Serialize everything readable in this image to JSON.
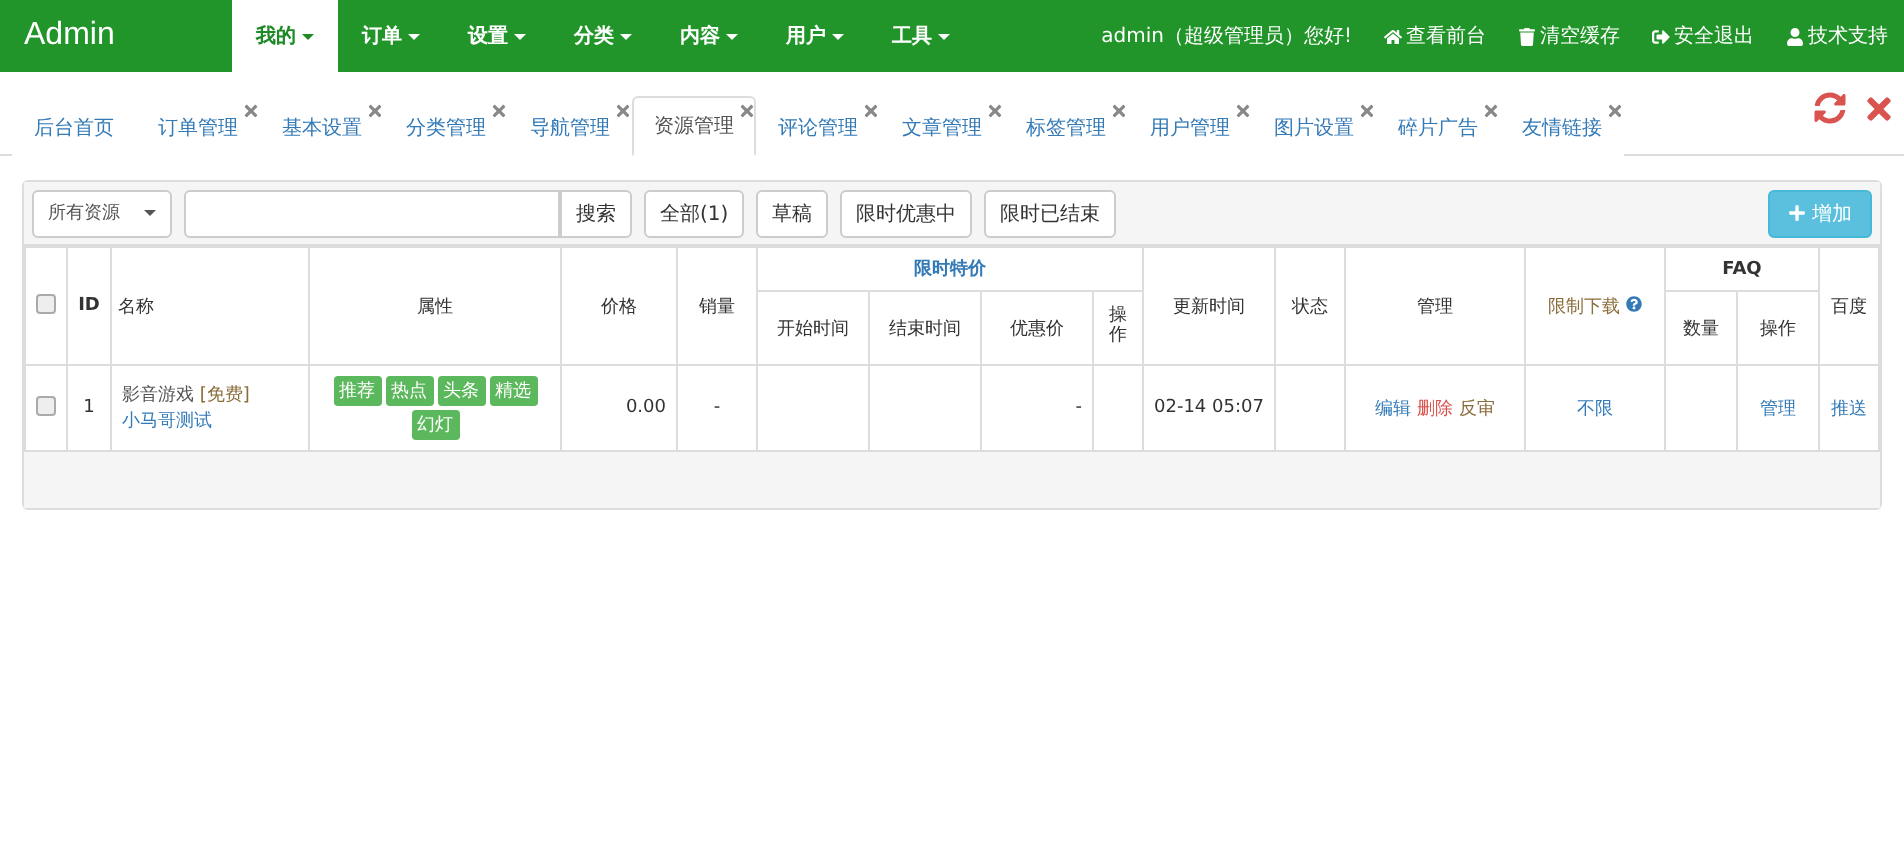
{
  "brand": "Admin",
  "menus": [
    {
      "label": "我的",
      "selected": true
    },
    {
      "label": "订单",
      "selected": false
    },
    {
      "label": "设置",
      "selected": false
    },
    {
      "label": "分类",
      "selected": false
    },
    {
      "label": "内容",
      "selected": false
    },
    {
      "label": "用户",
      "selected": false
    },
    {
      "label": "工具",
      "selected": false
    }
  ],
  "greeting": "admin（超级管理员）您好!",
  "top_links": [
    {
      "label": "查看前台",
      "kind": "home"
    },
    {
      "label": "清空缓存",
      "kind": "trash"
    },
    {
      "label": "安全退出",
      "kind": "logout"
    },
    {
      "label": "技术支持",
      "kind": "user"
    }
  ],
  "tabs": [
    {
      "label": "后台首页",
      "selected": false,
      "closable": false
    },
    {
      "label": "订单管理",
      "selected": false,
      "closable": true
    },
    {
      "label": "基本设置",
      "selected": false,
      "closable": true
    },
    {
      "label": "分类管理",
      "selected": false,
      "closable": true
    },
    {
      "label": "导航管理",
      "selected": false,
      "closable": true
    },
    {
      "label": "资源管理",
      "selected": true,
      "closable": true
    },
    {
      "label": "评论管理",
      "selected": false,
      "closable": true
    },
    {
      "label": "文章管理",
      "selected": false,
      "closable": true
    },
    {
      "label": "标签管理",
      "selected": false,
      "closable": true
    },
    {
      "label": "用户管理",
      "selected": false,
      "closable": true
    },
    {
      "label": "图片设置",
      "selected": false,
      "closable": true
    },
    {
      "label": "碎片广告",
      "selected": false,
      "closable": true
    },
    {
      "label": "友情链接",
      "selected": false,
      "closable": true
    }
  ],
  "toolbar": {
    "filter": "所有资源",
    "search_button": "搜索",
    "buttons": [
      "全部(1)",
      "草稿",
      "限时优惠中",
      "限时已结束"
    ],
    "add_button": "增加"
  },
  "table": {
    "headers": {
      "id": "ID",
      "name": "名称",
      "attr": "属性",
      "price": "价格",
      "sales": "销量",
      "special": "限时特价",
      "start": "开始时间",
      "end": "结束时间",
      "discount": "优惠价",
      "op": "操作",
      "updated": "更新时间",
      "status": "状态",
      "manage": "管理",
      "limit": "限制下载",
      "faq": "FAQ",
      "faq_count": "数量",
      "faq_op": "操作",
      "baidu": "百度"
    },
    "select_all_checked": false,
    "rows": [
      {
        "checked": false,
        "id": "1",
        "category": "影音游戏",
        "free": "[免费]",
        "title": "小马哥测试",
        "tags": [
          "推荐",
          "热点",
          "头条",
          "精选",
          "幻灯"
        ],
        "price": "0.00",
        "sales": "-",
        "discount": "-",
        "updated": "02-14 05:07",
        "actions": [
          {
            "label": "编辑",
            "kind": "edit"
          },
          {
            "label": "删除",
            "kind": "delete"
          },
          {
            "label": "反审",
            "kind": "review"
          }
        ],
        "limit": "不限",
        "faq_op": "管理",
        "baidu": "推送"
      }
    ]
  }
}
